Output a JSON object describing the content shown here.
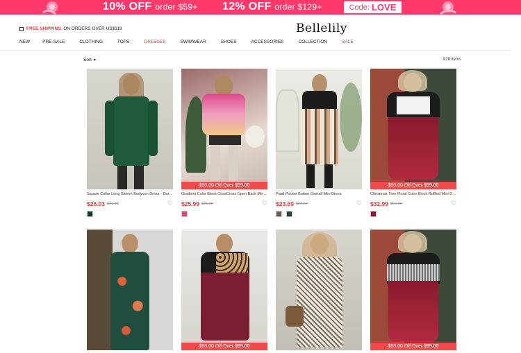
{
  "promo": {
    "offer1_main": "10% OFF",
    "offer1_sub": "order $59+",
    "offer2_main": "12% OFF",
    "offer2_sub": "order $129+",
    "code_label": "Code:",
    "code_value": "LOVE"
  },
  "header": {
    "shipping_bold": "FREE SHIPPING",
    "shipping_rest": "ON ORDERS OVER US$119",
    "logo": "Bellelily"
  },
  "nav": [
    "NEW",
    "PRE-SALE",
    "CLOTHING",
    "TOPS",
    "DRESSES",
    "SWIMWEAR",
    "SHOES",
    "ACCESSORIES",
    "COLLECTION",
    "SALE"
  ],
  "toolbar": {
    "sort_label": "Sort",
    "item_count": "878 items"
  },
  "products": [
    {
      "name": "Square Collar Long Sleeve Bodycon Dress - Dark ...",
      "price": "$26.03",
      "old_price": "$31.88",
      "tag": "",
      "swatches": [
        "#0f3a26"
      ]
    },
    {
      "name": "Gradient Color Block CrissCross Open Back Mini ...",
      "price": "$25.99",
      "old_price": "$35.99",
      "tag": "$50.00 Off Over $99.00",
      "swatches": [
        "#d4477a"
      ]
    },
    {
      "name": "Plaid Pocket Button Overall Mini Dress",
      "price": "$23.69",
      "old_price": "$28.59",
      "tag": "",
      "swatches": [
        "#6b5a4a",
        "#2f3e3a"
      ]
    },
    {
      "name": "Christmas Tree Floral Color Block Ruffled Mini Dre...",
      "price": "$32.99",
      "old_price": "$54.99",
      "tag": "$50.00 Off Over $99.00",
      "swatches": [
        "#8a1b2c"
      ]
    },
    {
      "name": "",
      "price": "",
      "old_price": "",
      "tag": "",
      "swatches": []
    },
    {
      "name": "",
      "price": "",
      "old_price": "",
      "tag": "$50.00 Off Over $99.00",
      "swatches": []
    },
    {
      "name": "",
      "price": "",
      "old_price": "",
      "tag": "",
      "swatches": []
    },
    {
      "name": "",
      "price": "",
      "old_price": "",
      "tag": "$50.00 Off Over $99.00",
      "swatches": []
    }
  ],
  "colors": {
    "promo_bg": "#ff3a6b",
    "accent_red": "#e13a3a",
    "tag_bg": "#f04a4a"
  }
}
